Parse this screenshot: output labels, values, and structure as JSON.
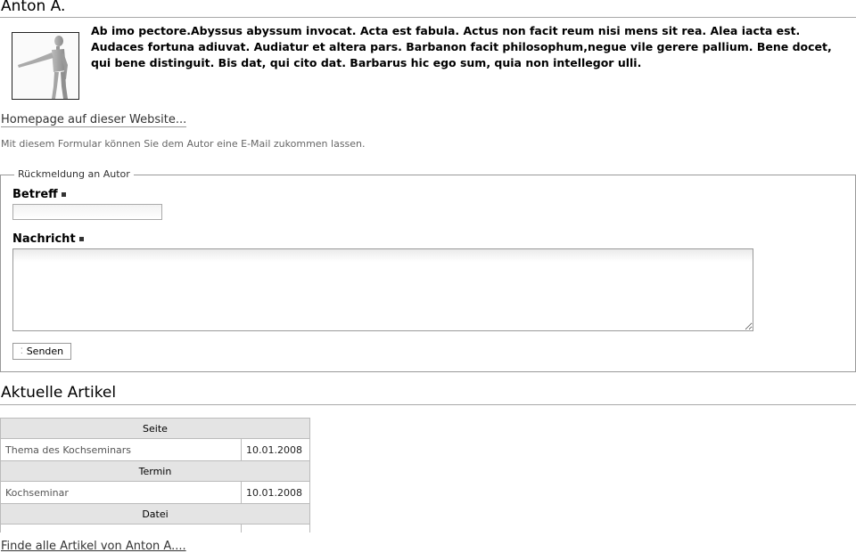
{
  "author": {
    "name": "Anton A.",
    "bio": "Ab imo pectore.Abyssus abyssum invocat. Acta est fabula. Actus non facit reum nisi mens sit rea. Alea iacta est. Audaces fortuna adiuvat. Audiatur et altera pars. Barbanon facit philosophum,negue vile gerere pallium. Bene docet, qui bene distinguit. Bis dat, qui cito dat. Barbarus hic ego sum, quia non intellegor ulli.",
    "homepage_link": "Homepage auf dieser Website..."
  },
  "contact": {
    "intro": "Mit diesem Formular können Sie dem Autor eine E-Mail zukommen lassen.",
    "legend": "Rückmeldung an Autor",
    "subject_label": "Betreff",
    "subject_value": "",
    "message_label": "Nachricht",
    "message_value": "",
    "send_button": "Senden"
  },
  "articles": {
    "heading": "Aktuelle Artikel",
    "sections": [
      {
        "header": "Seite",
        "title": "Thema des Kochseminars",
        "date": "10.01.2008"
      },
      {
        "header": "Termin",
        "title": "Kochseminar",
        "date": "10.01.2008"
      },
      {
        "header": "Datei",
        "title": "",
        "date": ""
      }
    ],
    "find_all_link": "Finde alle Artikel von Anton A...."
  },
  "icons": {
    "portrait": "wooden-mannequin-image",
    "send": "send-icon"
  }
}
